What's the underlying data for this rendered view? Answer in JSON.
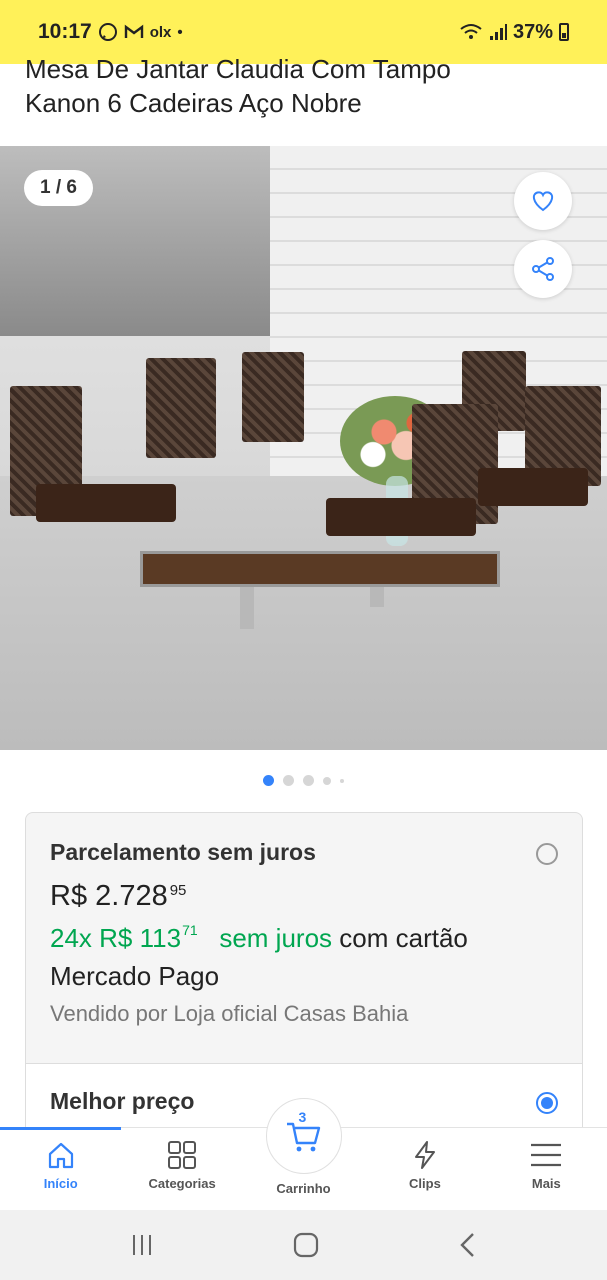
{
  "status_bar": {
    "time": "10:17",
    "notif_icons": [
      "whatsapp-icon",
      "gmail-icon"
    ],
    "olx_label": "olx",
    "dot": "•",
    "battery": "37%"
  },
  "product": {
    "title_line1": "Mesa De Jantar Claudia Com Tampo",
    "title_line2": "Kanon 6 Cadeiras Aço Nobre"
  },
  "gallery": {
    "counter": "1 / 6",
    "dots_count": 5,
    "active_index": 0
  },
  "offers": [
    {
      "title": "Parcelamento sem juros",
      "selected": false,
      "price_int": "R$ 2.728",
      "price_cents": "95",
      "install_count": "24x",
      "install_int": "R$ 113",
      "install_cents": "71",
      "install_suffix_green": "sem juros",
      "install_suffix": "com cartão",
      "install_line2": "Mercado Pago",
      "seller": "Vendido por Loja oficial Casas Bahia"
    },
    {
      "title": "Melhor preço",
      "selected": true
    }
  ],
  "bottom_nav": {
    "items": [
      {
        "label": "Início",
        "icon": "home-icon",
        "active": true
      },
      {
        "label": "Categorias",
        "icon": "grid-icon",
        "active": false
      },
      {
        "label": "Carrinho",
        "icon": "cart-icon",
        "active": false,
        "count": "3"
      },
      {
        "label": "Clips",
        "icon": "lightning-icon",
        "active": false
      },
      {
        "label": "Mais",
        "icon": "menu-icon",
        "active": false
      }
    ]
  },
  "colors": {
    "brand_yellow": "#fff159",
    "accent_blue": "#3483fa",
    "green": "#00a650"
  }
}
